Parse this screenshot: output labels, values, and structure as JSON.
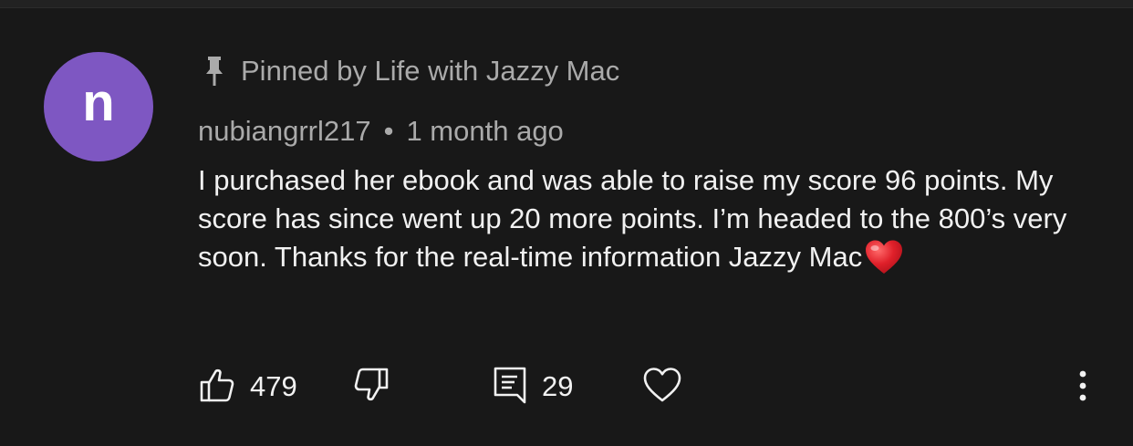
{
  "comment": {
    "avatar_letter": "n",
    "avatar_color": "#7e57c2",
    "pinned_text": "Pinned by Life with Jazzy Mac",
    "author": "nubiangrrl217",
    "separator": "•",
    "timestamp": "1 month ago",
    "text": "I purchased her ebook and was able to raise my score 96 points. My score has since went up 20 more points. I’m headed to the 800’s very soon. Thanks for the real-time information Jazzy Mac",
    "emoji": "red-heart-emoji"
  },
  "actions": {
    "like_count": "479",
    "reply_count": "29"
  },
  "icons": {
    "pin": "pin-icon",
    "like": "thumbs-up-icon",
    "dislike": "thumbs-down-icon",
    "reply": "comment-icon",
    "heart": "heart-icon",
    "more": "more-vertical-icon"
  },
  "colors": {
    "background": "#181818",
    "text_primary": "#f1f1f1",
    "text_secondary": "#aaaaaa",
    "heart_red": "#e0202a"
  }
}
